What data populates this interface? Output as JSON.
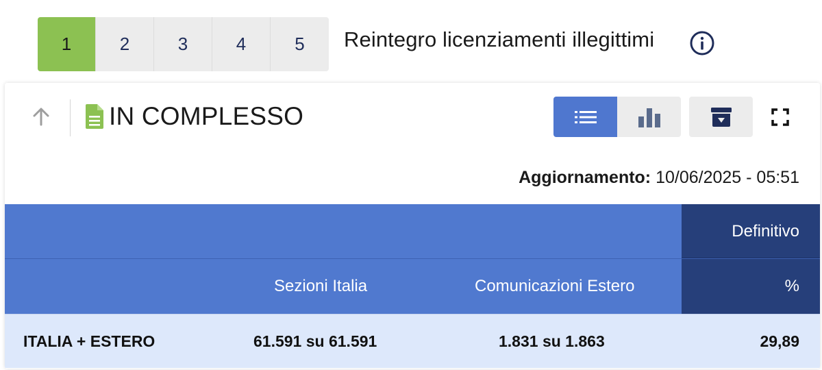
{
  "tabs": [
    {
      "label": "1",
      "active": true
    },
    {
      "label": "2",
      "active": false
    },
    {
      "label": "3",
      "active": false
    },
    {
      "label": "4",
      "active": false
    },
    {
      "label": "5",
      "active": false
    }
  ],
  "tab_title": "Reintegro licenziamenti illegittimi",
  "card": {
    "title": "IN COMPLESSO",
    "update_label": "Aggiornamento:",
    "update_value": "10/06/2025 - 05:51"
  },
  "table": {
    "group_header": "Definitivo",
    "columns": [
      "",
      "Sezioni Italia",
      "Comunicazioni Estero",
      "%"
    ],
    "rows": [
      {
        "label": "ITALIA + ESTERO",
        "sezioni": "61.591 su 61.591",
        "estero": "1.831 su 1.863",
        "percent": "29,89"
      }
    ]
  },
  "colors": {
    "tab_active": "#8cc152",
    "header_blue": "#5079cf",
    "header_dark": "#263f7a",
    "row_bg": "#dde8fb",
    "doc_icon": "#8cc152"
  }
}
